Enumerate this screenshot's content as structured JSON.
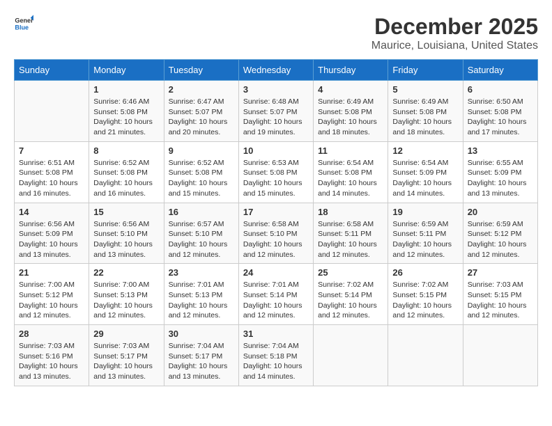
{
  "header": {
    "logo_line1": "General",
    "logo_line2": "Blue",
    "title": "December 2025",
    "subtitle": "Maurice, Louisiana, United States"
  },
  "calendar": {
    "days_of_week": [
      "Sunday",
      "Monday",
      "Tuesday",
      "Wednesday",
      "Thursday",
      "Friday",
      "Saturday"
    ],
    "weeks": [
      [
        {
          "day": "",
          "info": ""
        },
        {
          "day": "1",
          "info": "Sunrise: 6:46 AM\nSunset: 5:08 PM\nDaylight: 10 hours\nand 21 minutes."
        },
        {
          "day": "2",
          "info": "Sunrise: 6:47 AM\nSunset: 5:07 PM\nDaylight: 10 hours\nand 20 minutes."
        },
        {
          "day": "3",
          "info": "Sunrise: 6:48 AM\nSunset: 5:07 PM\nDaylight: 10 hours\nand 19 minutes."
        },
        {
          "day": "4",
          "info": "Sunrise: 6:49 AM\nSunset: 5:08 PM\nDaylight: 10 hours\nand 18 minutes."
        },
        {
          "day": "5",
          "info": "Sunrise: 6:49 AM\nSunset: 5:08 PM\nDaylight: 10 hours\nand 18 minutes."
        },
        {
          "day": "6",
          "info": "Sunrise: 6:50 AM\nSunset: 5:08 PM\nDaylight: 10 hours\nand 17 minutes."
        }
      ],
      [
        {
          "day": "7",
          "info": "Sunrise: 6:51 AM\nSunset: 5:08 PM\nDaylight: 10 hours\nand 16 minutes."
        },
        {
          "day": "8",
          "info": "Sunrise: 6:52 AM\nSunset: 5:08 PM\nDaylight: 10 hours\nand 16 minutes."
        },
        {
          "day": "9",
          "info": "Sunrise: 6:52 AM\nSunset: 5:08 PM\nDaylight: 10 hours\nand 15 minutes."
        },
        {
          "day": "10",
          "info": "Sunrise: 6:53 AM\nSunset: 5:08 PM\nDaylight: 10 hours\nand 15 minutes."
        },
        {
          "day": "11",
          "info": "Sunrise: 6:54 AM\nSunset: 5:08 PM\nDaylight: 10 hours\nand 14 minutes."
        },
        {
          "day": "12",
          "info": "Sunrise: 6:54 AM\nSunset: 5:09 PM\nDaylight: 10 hours\nand 14 minutes."
        },
        {
          "day": "13",
          "info": "Sunrise: 6:55 AM\nSunset: 5:09 PM\nDaylight: 10 hours\nand 13 minutes."
        }
      ],
      [
        {
          "day": "14",
          "info": "Sunrise: 6:56 AM\nSunset: 5:09 PM\nDaylight: 10 hours\nand 13 minutes."
        },
        {
          "day": "15",
          "info": "Sunrise: 6:56 AM\nSunset: 5:10 PM\nDaylight: 10 hours\nand 13 minutes."
        },
        {
          "day": "16",
          "info": "Sunrise: 6:57 AM\nSunset: 5:10 PM\nDaylight: 10 hours\nand 12 minutes."
        },
        {
          "day": "17",
          "info": "Sunrise: 6:58 AM\nSunset: 5:10 PM\nDaylight: 10 hours\nand 12 minutes."
        },
        {
          "day": "18",
          "info": "Sunrise: 6:58 AM\nSunset: 5:11 PM\nDaylight: 10 hours\nand 12 minutes."
        },
        {
          "day": "19",
          "info": "Sunrise: 6:59 AM\nSunset: 5:11 PM\nDaylight: 10 hours\nand 12 minutes."
        },
        {
          "day": "20",
          "info": "Sunrise: 6:59 AM\nSunset: 5:12 PM\nDaylight: 10 hours\nand 12 minutes."
        }
      ],
      [
        {
          "day": "21",
          "info": "Sunrise: 7:00 AM\nSunset: 5:12 PM\nDaylight: 10 hours\nand 12 minutes."
        },
        {
          "day": "22",
          "info": "Sunrise: 7:00 AM\nSunset: 5:13 PM\nDaylight: 10 hours\nand 12 minutes."
        },
        {
          "day": "23",
          "info": "Sunrise: 7:01 AM\nSunset: 5:13 PM\nDaylight: 10 hours\nand 12 minutes."
        },
        {
          "day": "24",
          "info": "Sunrise: 7:01 AM\nSunset: 5:14 PM\nDaylight: 10 hours\nand 12 minutes."
        },
        {
          "day": "25",
          "info": "Sunrise: 7:02 AM\nSunset: 5:14 PM\nDaylight: 10 hours\nand 12 minutes."
        },
        {
          "day": "26",
          "info": "Sunrise: 7:02 AM\nSunset: 5:15 PM\nDaylight: 10 hours\nand 12 minutes."
        },
        {
          "day": "27",
          "info": "Sunrise: 7:03 AM\nSunset: 5:15 PM\nDaylight: 10 hours\nand 12 minutes."
        }
      ],
      [
        {
          "day": "28",
          "info": "Sunrise: 7:03 AM\nSunset: 5:16 PM\nDaylight: 10 hours\nand 13 minutes."
        },
        {
          "day": "29",
          "info": "Sunrise: 7:03 AM\nSunset: 5:17 PM\nDaylight: 10 hours\nand 13 minutes."
        },
        {
          "day": "30",
          "info": "Sunrise: 7:04 AM\nSunset: 5:17 PM\nDaylight: 10 hours\nand 13 minutes."
        },
        {
          "day": "31",
          "info": "Sunrise: 7:04 AM\nSunset: 5:18 PM\nDaylight: 10 hours\nand 14 minutes."
        },
        {
          "day": "",
          "info": ""
        },
        {
          "day": "",
          "info": ""
        },
        {
          "day": "",
          "info": ""
        }
      ]
    ]
  }
}
